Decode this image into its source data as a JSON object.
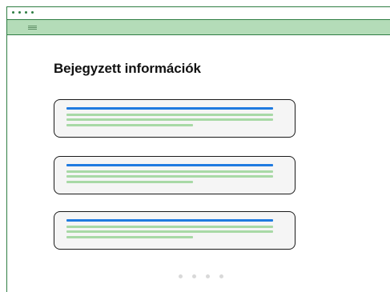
{
  "window": {
    "title_dots": 4
  },
  "toolbar": {
    "menu_icon": "hamburger-menu-icon"
  },
  "main": {
    "heading": "Bejegyzett információk",
    "cards": [
      {
        "lines": [
          "title-placeholder",
          "text-placeholder",
          "text-placeholder",
          "text-placeholder"
        ]
      },
      {
        "lines": [
          "title-placeholder",
          "text-placeholder",
          "text-placeholder",
          "text-placeholder"
        ]
      },
      {
        "lines": [
          "title-placeholder",
          "text-placeholder",
          "text-placeholder",
          "text-placeholder"
        ]
      }
    ]
  },
  "pagination": {
    "pages": 4,
    "current": 1
  },
  "colors": {
    "accent_green": "#2f7d43",
    "toolbar_green": "#b4dcb8",
    "title_blue": "#1f7ae0",
    "text_line_green": "#a8d9a6",
    "card_background": "#f5f5f5",
    "pager_dot": "#d9d9d9"
  }
}
